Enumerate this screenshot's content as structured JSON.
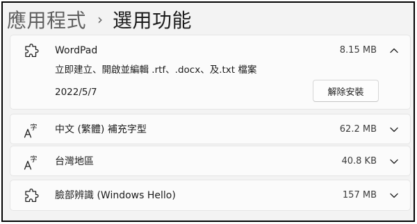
{
  "breadcrumb": {
    "parent": "應用程式",
    "separator": "›",
    "current": "選用功能"
  },
  "features": [
    {
      "name": "WordPad",
      "size": "8.15 MB",
      "icon": "puzzle-icon",
      "expanded": true,
      "description": "立即建立、開啟並編輯 .rtf、.docx、及.txt 檔案",
      "install_date": "2022/5/7",
      "uninstall_label": "解除安裝"
    },
    {
      "name": "中文 (繁體) 補充字型",
      "size": "62.2 MB",
      "icon": "font-icon",
      "expanded": false
    },
    {
      "name": "台灣地區",
      "size": "40.8 KB",
      "icon": "font-icon",
      "expanded": false
    },
    {
      "name": "臉部辨識 (Windows Hello)",
      "size": "157 MB",
      "icon": "puzzle-icon",
      "expanded": false
    }
  ]
}
